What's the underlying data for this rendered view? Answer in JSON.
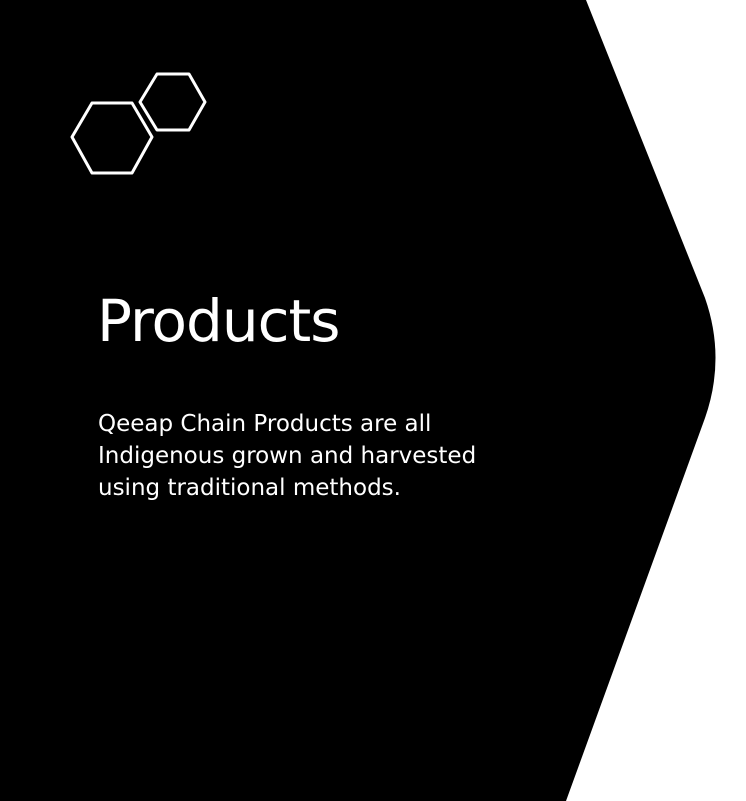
{
  "colors": {
    "panel": "#000000",
    "background": "#ffffff",
    "text": "#ffffff",
    "icon_stroke": "#ffffff"
  },
  "icons": {
    "logo": "two-hexagons-icon"
  },
  "slide": {
    "title": "Products",
    "body_lines": [
      "Qeeap Chain Products are all",
      "Indigenous grown and harvested",
      "using traditional methods."
    ]
  }
}
